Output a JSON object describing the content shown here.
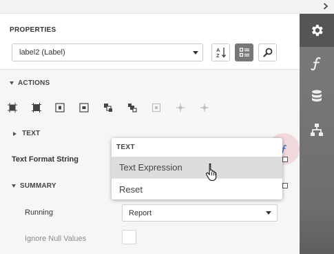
{
  "panel": {
    "title": "PROPERTIES",
    "object_selector": {
      "value": "label2 (Label)"
    }
  },
  "sections": {
    "actions": "ACTIONS",
    "text": "TEXT",
    "summary": "SUMMARY"
  },
  "properties": {
    "text_format_string": "Text Format String",
    "running": {
      "label": "Running",
      "value": "Report"
    },
    "ignore_null_values": "Ignore Null Values"
  },
  "popup": {
    "header": "TEXT",
    "items": [
      "Text Expression",
      "Reset"
    ]
  },
  "colors": {
    "right_bar": "#6e6e6e",
    "right_bar_active": "#555555",
    "accent_blue": "#3b6fd8",
    "fx_highlight": "#f2d9dc"
  }
}
